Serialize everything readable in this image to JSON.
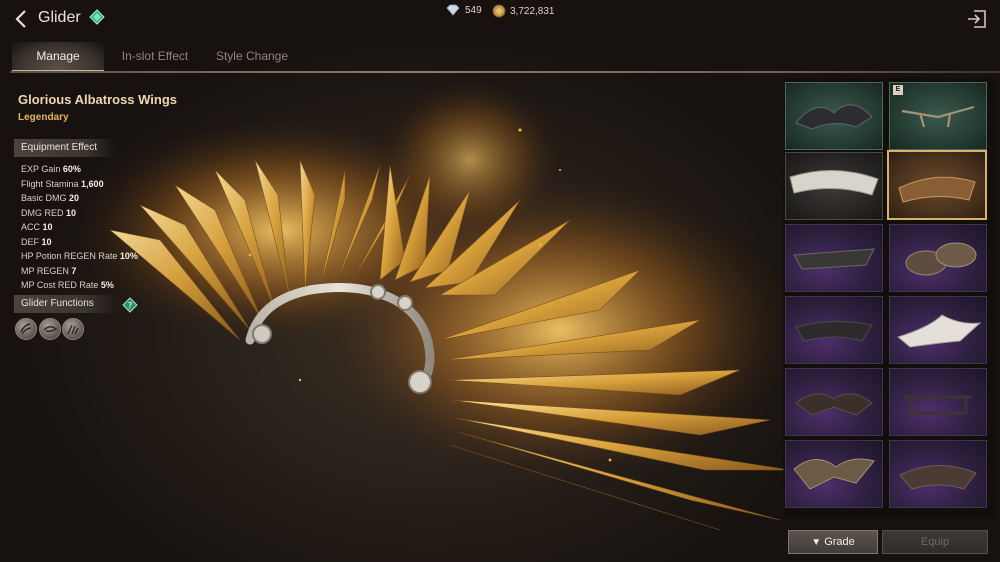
{
  "header": {
    "title": "Glider",
    "currency": [
      {
        "icon": "diamond-icon",
        "value": "549"
      },
      {
        "icon": "gold-coin-icon",
        "value": "3,722,831"
      }
    ]
  },
  "tabs": [
    {
      "label": "Manage",
      "active": true
    },
    {
      "label": "In-slot Effect",
      "active": false
    },
    {
      "label": "Style Change",
      "active": false
    }
  ],
  "item": {
    "name": "Glorious Albatross Wings",
    "grade": "Legendary"
  },
  "equipment_effect": {
    "heading": "Equipment Effect",
    "stats": [
      {
        "label": "EXP Gain",
        "value": "60%"
      },
      {
        "label": "Flight Stamina",
        "value": "1,600"
      },
      {
        "label": "Basic DMG",
        "value": "20"
      },
      {
        "label": "DMG RED",
        "value": "10"
      },
      {
        "label": "ACC",
        "value": "10"
      },
      {
        "label": "DEF",
        "value": "10"
      },
      {
        "label": "HP Potion REGEN Rate",
        "value": "10%"
      },
      {
        "label": "MP REGEN",
        "value": "7"
      },
      {
        "label": "MP Cost RED Rate",
        "value": "5%"
      }
    ]
  },
  "glider_functions": {
    "heading": "Glider Functions",
    "icons": [
      "wind-dash-icon",
      "spiral-glide-icon",
      "wing-boost-icon"
    ]
  },
  "grid": {
    "cells": [
      {
        "style": "teal",
        "equipped": false,
        "selected": false
      },
      {
        "style": "teal",
        "equipped": true,
        "badge": "E",
        "selected": false
      },
      {
        "style": "dark",
        "equipped": false,
        "selected": false
      },
      {
        "style": "brown",
        "equipped": false,
        "selected": true
      },
      {
        "style": "purple",
        "equipped": false,
        "selected": false
      },
      {
        "style": "purple",
        "equipped": false,
        "selected": false
      },
      {
        "style": "purple",
        "equipped": false,
        "selected": false
      },
      {
        "style": "purple",
        "equipped": false,
        "selected": false
      },
      {
        "style": "purple",
        "equipped": false,
        "selected": false
      },
      {
        "style": "purple",
        "equipped": false,
        "selected": false
      },
      {
        "style": "purple",
        "equipped": false,
        "selected": false
      },
      {
        "style": "purple",
        "equipped": false,
        "selected": false
      }
    ]
  },
  "buttons": {
    "grade": "Grade",
    "equip": "Equip"
  },
  "colors": {
    "legendary": "#e5b45a",
    "gold_wing": "#e0a83a",
    "panel_bg": "#1a1512"
  }
}
